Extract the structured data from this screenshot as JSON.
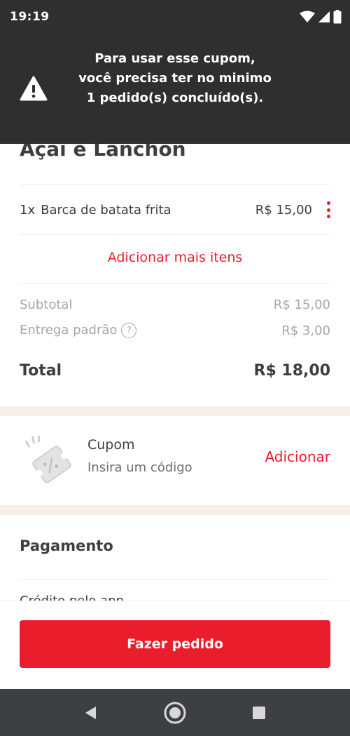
{
  "status_bar": {
    "time": "19:19"
  },
  "toast": {
    "message": "Para usar esse cupom, você precisa ter no minimo 1 pedido(s) concluído(s)."
  },
  "restaurant": {
    "name": "Açaí e Lanchon"
  },
  "cart": {
    "items": [
      {
        "qty": "1x",
        "name": "Barca de batata frita",
        "price": "R$ 15,00"
      }
    ],
    "add_more_label": "Adicionar mais itens"
  },
  "summary": {
    "subtotal_label": "Subtotal",
    "subtotal_value": "R$ 15,00",
    "delivery_label": "Entrega padrão",
    "delivery_help": "?",
    "delivery_value": "R$ 3,00",
    "total_label": "Total",
    "total_value": "R$ 18,00"
  },
  "coupon": {
    "title": "Cupom",
    "subtitle": "Insira um código",
    "action_label": "Adicionar"
  },
  "payment": {
    "title": "Pagamento",
    "partial_text": "Crédito pelo app"
  },
  "order_button": {
    "label": "Fazer pedido"
  },
  "colors": {
    "accent": "#ea1d2c",
    "toast_bg": "#2f2f2f",
    "band": "#f4efeb",
    "navbar": "#3c4043"
  },
  "icons": {
    "warning": "warning-icon",
    "coupon": "coupon-ticket-icon",
    "wifi": "wifi-icon",
    "signal": "signal-icon",
    "battery": "battery-icon"
  }
}
